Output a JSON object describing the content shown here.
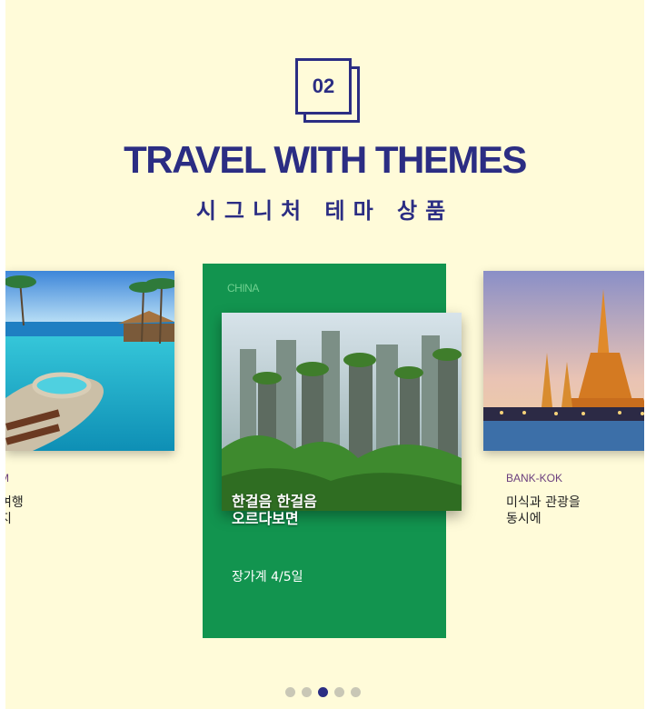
{
  "section": {
    "number": "02",
    "title": "TRAVEL WITH THEMES",
    "subtitle": "시그니처 테마 상품"
  },
  "cards": {
    "left": {
      "tag": "M",
      "desc": "여행\n지"
    },
    "center": {
      "tag": "CHINA",
      "desc": "한걸음 한걸음\n오르다보면",
      "sub": "장가계 4/5일"
    },
    "right": {
      "tag": "BANK-KOK",
      "desc": "미식과 관광을\n동시에"
    }
  },
  "pagination": {
    "count": 5,
    "active_index": 2
  },
  "colors": {
    "brand": "#2b2d83",
    "background": "#fffbd9",
    "center_card": "#12944f",
    "tag": "#6b3f7e"
  }
}
